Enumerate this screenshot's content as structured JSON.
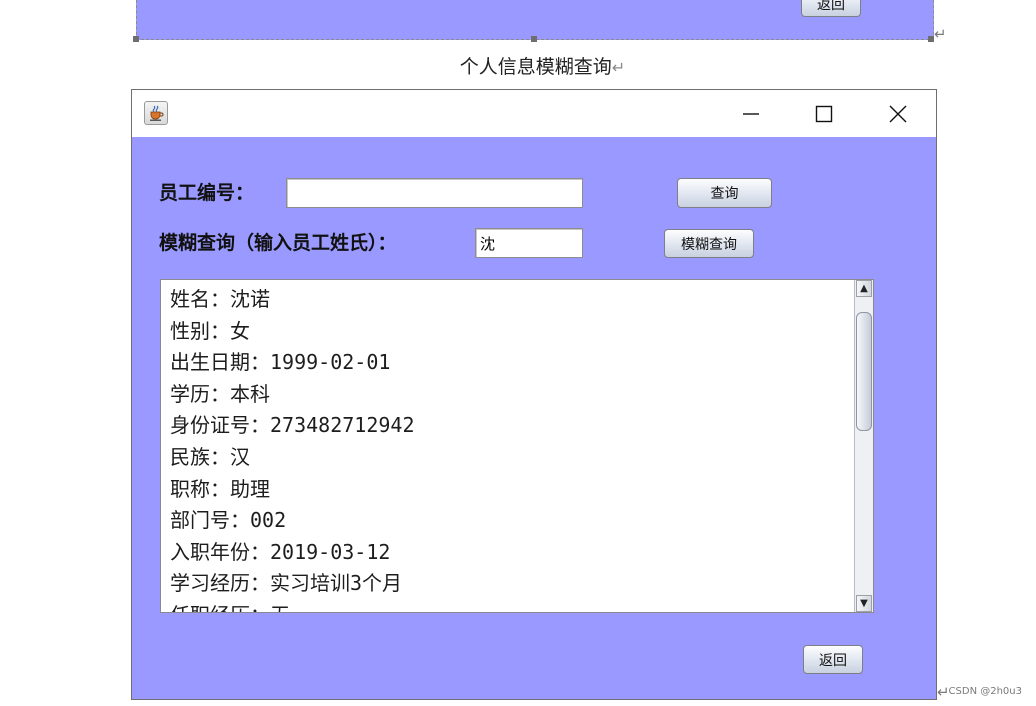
{
  "previous_window": {
    "return_button_label": "返回"
  },
  "caption": "个人信息模糊查询",
  "paragraph_mark": "↵",
  "window": {
    "title": "",
    "icon": "java-coffee-cup-icon",
    "controls": {
      "minimize_icon": "minimize-icon",
      "maximize_icon": "maximize-icon",
      "close_icon": "close-icon"
    },
    "employee_id": {
      "label": "员工编号：",
      "value": "",
      "query_button": "查询"
    },
    "fuzzy": {
      "label": "模糊查询（输入员工姓氏）：",
      "value": "沈",
      "button": "模糊查询"
    },
    "results": [
      "姓名：沈诺",
      "性别：女",
      "出生日期：1999-02-01",
      "学历：本科",
      "身份证号：273482712942",
      "民族：汉",
      "职称：助理",
      "部门号：002",
      "入职年份：2019-03-12",
      "学习经历：实习培训3个月",
      "任职经历：无"
    ],
    "scroll_up_glyph": "▲",
    "scroll_down_glyph": "▼",
    "return_button_label": "返回"
  },
  "watermark": "CSDN @2h0u3",
  "colors": {
    "window_background": "#9999ff",
    "title_bar": "#ffffff",
    "text_area_background": "#ffffff"
  }
}
